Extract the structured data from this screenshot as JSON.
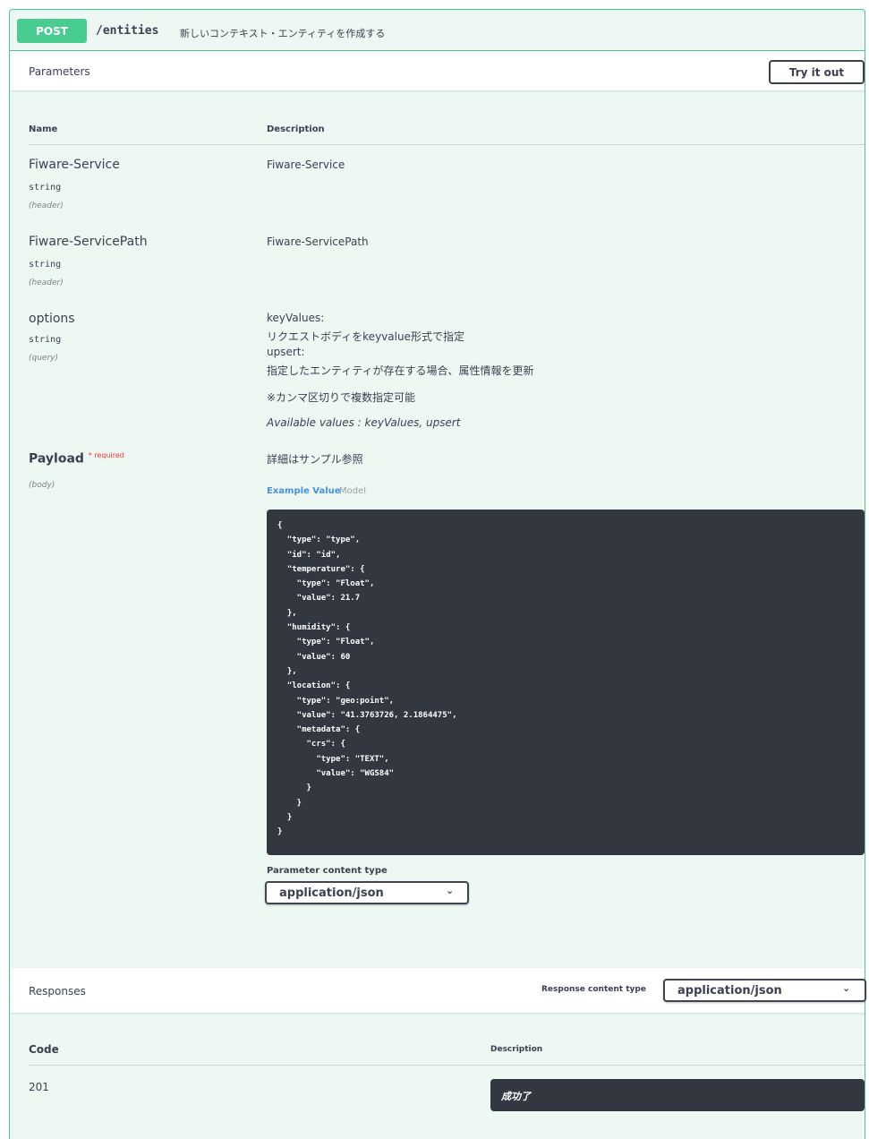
{
  "operation": {
    "method": "POST",
    "path": "/entities",
    "summary": "新しいコンテキスト・エンティティを作成する"
  },
  "parameters_section": {
    "title": "Parameters",
    "try_button": "Try it out",
    "col_name": "Name",
    "col_description": "Description",
    "params": [
      {
        "name": "Fiware-Service",
        "type": "string",
        "in": "(header)",
        "description": "Fiware-Service"
      },
      {
        "name": "Fiware-ServicePath",
        "type": "string",
        "in": "(header)",
        "description": "Fiware-ServicePath"
      },
      {
        "name": "options",
        "type": "string",
        "in": "(query)",
        "desc_lines": [
          "keyValues:",
          "リクエストボディをkeyvalue形式で指定",
          "upsert:",
          "指定したエンティティが存在する場合、属性情報を更新"
        ],
        "note": "※カンマ区切りで複数指定可能",
        "available": "Available values : keyValues, upsert"
      }
    ],
    "payload": {
      "name": "Payload",
      "required": "* required",
      "in": "(body)",
      "description": "詳細はサンプル参照",
      "tab_example": "Example Value",
      "tab_model": "Model",
      "example_json": "{\n  \"type\": \"type\",\n  \"id\": \"id\",\n  \"temperature\": {\n    \"type\": \"Float\",\n    \"value\": 21.7\n  },\n  \"humidity\": {\n    \"type\": \"Float\",\n    \"value\": 60\n  },\n  \"location\": {\n    \"type\": \"geo:point\",\n    \"value\": \"41.3763726, 2.1864475\",\n    \"metadata\": {\n      \"crs\": {\n        \"type\": \"TEXT\",\n        \"value\": \"WGS84\"\n      }\n    }\n  }\n}",
      "content_type_label": "Parameter content type",
      "content_type_value": "application/json"
    }
  },
  "responses_section": {
    "title": "Responses",
    "content_type_label": "Response content type",
    "content_type_value": "application/json",
    "col_code": "Code",
    "col_description": "Description",
    "rows": [
      {
        "code": "201",
        "description": "成功了"
      }
    ]
  },
  "icons": {
    "select_chevron": "chevron-down-icon"
  },
  "colors": {
    "post_accent": "#49cc90",
    "block_bg": "#edf8f3",
    "code_bg": "#333840"
  }
}
